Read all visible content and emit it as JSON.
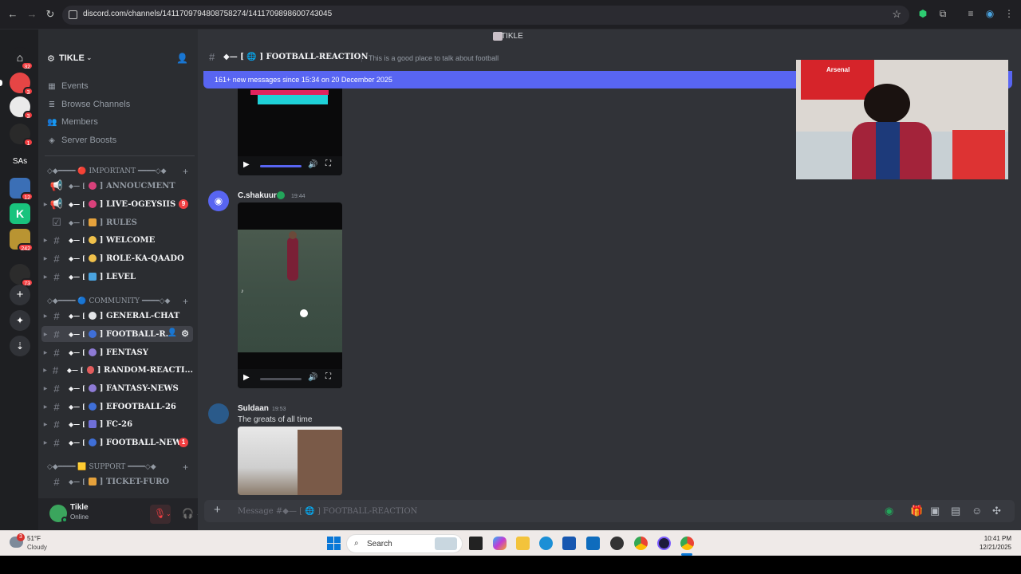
{
  "browser": {
    "url": "discord.com/channels/1411709794808758274/1411709898600743045"
  },
  "window_title": "TIKLE",
  "servers": [
    {
      "name": "discord-home",
      "badge": "32"
    },
    {
      "name": "server-2",
      "badge": "3"
    },
    {
      "name": "server-3",
      "badge": "3"
    },
    {
      "name": "server-4",
      "badge": "1"
    },
    {
      "name": "SAs",
      "label": "SAs",
      "badge": ""
    },
    {
      "name": "server-6",
      "badge": "12"
    },
    {
      "name": "server-7",
      "badge": ""
    },
    {
      "name": "server-8",
      "badge": "242"
    },
    {
      "name": "server-9",
      "badge": "73"
    }
  ],
  "guild": {
    "name": "TIKLE",
    "links": [
      "Events",
      "Browse Channels",
      "Members",
      "Server Boosts"
    ]
  },
  "categories": {
    "important": "◇◆━━━━ 🔴 IMPORTANT ━━━━◇◆",
    "community": "◇◆━━━━ 🔵 COMMUNITY ━━━━◇◆",
    "support": "◇◆━━━━ 🟨 SUPPORT ━━━━◇◆"
  },
  "channels": [
    {
      "label": "ANNOUCMENT",
      "badge": ""
    },
    {
      "label": "LIVE-OGEYSIIS",
      "badge": "9"
    },
    {
      "label": "RULES",
      "badge": ""
    },
    {
      "label": "WELCOME",
      "badge": ""
    },
    {
      "label": "ROLE-KA-QAADO",
      "badge": ""
    },
    {
      "label": "LEVEL",
      "badge": ""
    },
    {
      "label": "GENERAL-CHAT",
      "badge": ""
    },
    {
      "label": "FOOTBALL-R...",
      "badge": ""
    },
    {
      "label": "FENTASY",
      "badge": ""
    },
    {
      "label": "RANDOM-REACTI...",
      "badge": ""
    },
    {
      "label": "FANTASY-NEWS",
      "badge": ""
    },
    {
      "label": "EFOOTBALL-26",
      "badge": ""
    },
    {
      "label": "FC-26",
      "badge": ""
    },
    {
      "label": "FOOTBALL-NEWS",
      "badge": "1"
    },
    {
      "label": "TICKET-FURO",
      "badge": ""
    }
  ],
  "deco": "◆— [",
  "deco_close": "]",
  "user": {
    "name": "Tikle",
    "status": "Online"
  },
  "channel_header": {
    "title": "◆— [ 🌐 ] FOOTBALL-REACTION",
    "topic": "This is a good place to talk about football"
  },
  "new_messages_banner": "161+ new messages since 15:34 on 20 December 2025",
  "messages": [
    {
      "author": "C.shakuur",
      "time": "19:44",
      "text": ""
    },
    {
      "author": "Suldaan",
      "time": "19:53",
      "text": "The greats of all time"
    }
  ],
  "composer_placeholder": "Message #◆— [ 🌐 ] FOOTBALL-REACTION",
  "webcam_flag_text": "Arsenal",
  "taskbar": {
    "weather_badge": "3",
    "temperature": "51°F",
    "weather": "Cloudy",
    "search": "Search",
    "time": "10:41 PM",
    "date": "12/21/2025"
  },
  "colors": {
    "blurple": "#5865f2",
    "danger": "#f23f42",
    "online": "#23a55a"
  }
}
